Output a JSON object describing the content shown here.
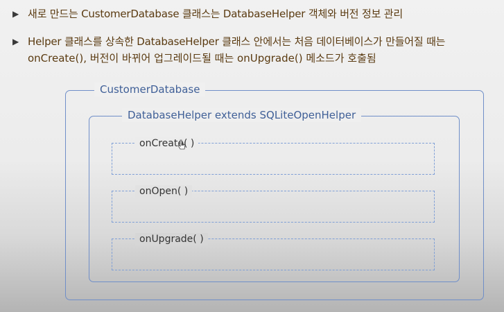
{
  "bullets": [
    {
      "icon": "triangle-bullet-icon",
      "text": "새로 만드는 CustomerDatabase 클래스는 DatabaseHelper 객체와 버전 정보 관리"
    },
    {
      "icon": "triangle-bullet-icon",
      "line1": "Helper 클래스를 상속한 DatabaseHelper 클래스 안에서는 처음 데이터베이스가 만들어질 때는",
      "line2": "onCreate(), 버전이 바뀌어 업그레이드될 때는 onUpgrade() 메소드가 호출됨"
    }
  ],
  "diagram": {
    "outer_label": "CustomerDatabase",
    "inner_label": "DatabaseHelper extends SQLiteOpenHelper",
    "methods": [
      "onCreate( )",
      "onOpen( )",
      "onUpgrade( )"
    ]
  },
  "colors": {
    "box_border": "#6f8ec8",
    "label_text": "#3f5f97",
    "bullet_text": "#5a3a10"
  }
}
